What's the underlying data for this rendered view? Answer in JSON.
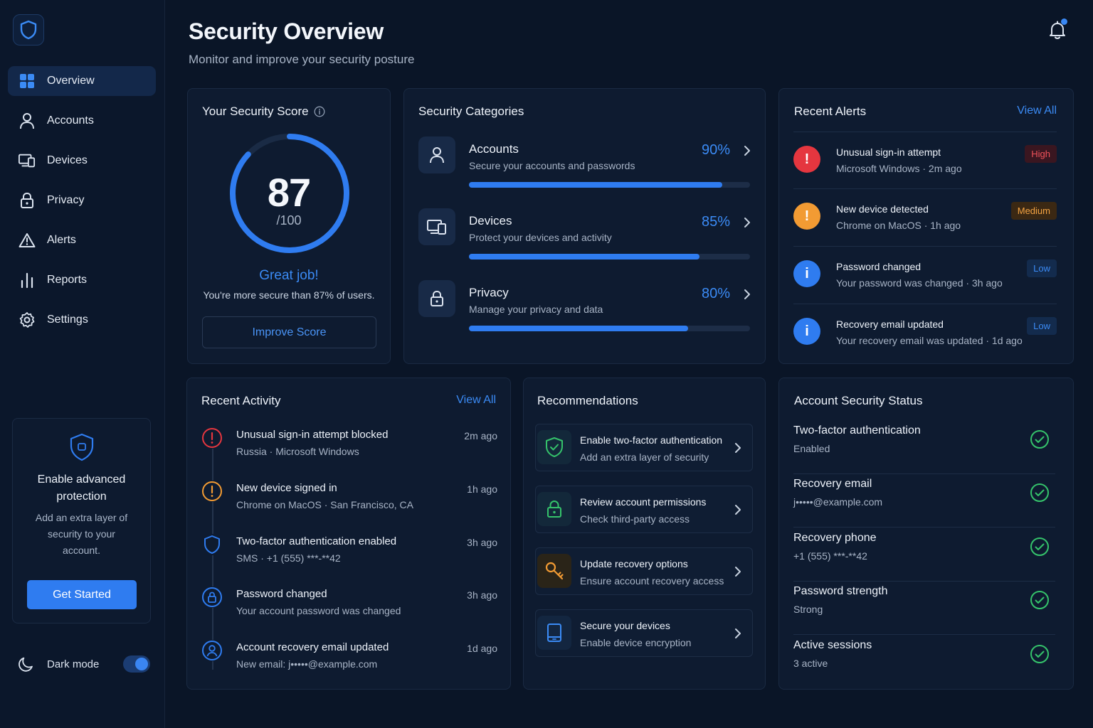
{
  "colors": {
    "accent": "#2f7cf0",
    "success": "#35c36b",
    "danger": "#e5363f",
    "warning": "#f29b33",
    "info": "#2f7cf0",
    "background": "#0a1527"
  },
  "sidebar": {
    "logo_icon": "shield-icon",
    "items": [
      {
        "label": "Overview",
        "icon": "grid-icon",
        "active": true
      },
      {
        "label": "Accounts",
        "icon": "user-icon"
      },
      {
        "label": "Devices",
        "icon": "devices-icon"
      },
      {
        "label": "Privacy",
        "icon": "lock-icon"
      },
      {
        "label": "Alerts",
        "icon": "warning-icon"
      },
      {
        "label": "Reports",
        "icon": "bar-chart-icon"
      },
      {
        "label": "Settings",
        "icon": "gear-icon"
      }
    ],
    "promo": {
      "title": "Enable advanced protection",
      "description": "Add an extra layer of security to your account.",
      "button": "Get Started"
    },
    "dark_mode": {
      "label": "Dark mode",
      "enabled": true
    }
  },
  "header": {
    "title": "Security Overview",
    "subtitle": "Monitor and improve your security posture",
    "notification_dot": true
  },
  "score": {
    "title": "Your Security Score",
    "value": "87",
    "max": "/100",
    "fraction": 0.87,
    "headline": "Great job!",
    "message": "You're more secure than 87% of users.",
    "button": "Improve Score"
  },
  "categories": {
    "title": "Security Categories",
    "items": [
      {
        "name": "Accounts",
        "description": "Secure your accounts and passwords",
        "percent": "90%",
        "value": 0.9,
        "icon": "user-icon"
      },
      {
        "name": "Devices",
        "description": "Protect your devices and activity",
        "percent": "85%",
        "value": 0.82,
        "icon": "devices-icon"
      },
      {
        "name": "Privacy",
        "description": "Manage your privacy and data",
        "percent": "80%",
        "value": 0.78,
        "icon": "lock-icon"
      }
    ]
  },
  "alerts": {
    "title": "Recent Alerts",
    "view_all": "View All",
    "items": [
      {
        "title": "Unusual sign-in attempt",
        "subtitle": "Microsoft Windows · 2m ago",
        "badge": "High",
        "level": "danger",
        "glyph": "!"
      },
      {
        "title": "New device detected",
        "subtitle": "Chrome on MacOS · 1h ago",
        "badge": "Medium",
        "level": "warning",
        "glyph": "!"
      },
      {
        "title": "Password changed",
        "subtitle": "Your password was changed · 3h ago",
        "badge": "Low",
        "level": "info",
        "glyph": "i"
      },
      {
        "title": "Recovery email updated",
        "subtitle": "Your recovery email was updated · 1d ago",
        "badge": "Low",
        "level": "info",
        "glyph": "i"
      }
    ]
  },
  "activity": {
    "title": "Recent Activity",
    "view_all": "View All",
    "items": [
      {
        "title": "Unusual sign-in attempt blocked",
        "subtitle": "Russia · Microsoft Windows",
        "time": "2m ago",
        "icon": "alert-circle-icon"
      },
      {
        "title": "New device signed in",
        "subtitle": "Chrome on MacOS · San Francisco, CA",
        "time": "1h ago",
        "icon": "warning-circle-icon"
      },
      {
        "title": "Two-factor authentication enabled",
        "subtitle": "SMS · +1 (555) ***-**42",
        "time": "3h ago",
        "icon": "shield-icon"
      },
      {
        "title": "Password changed",
        "subtitle": "Your account password was changed",
        "time": "3h ago",
        "icon": "lock-circle-icon"
      },
      {
        "title": "Account recovery email updated",
        "subtitle": "New email: j•••••@example.com",
        "time": "1d ago",
        "icon": "user-circle-icon"
      }
    ]
  },
  "recommendations": {
    "title": "Recommendations",
    "items": [
      {
        "title": "Enable two-factor authentication",
        "subtitle": "Add an extra layer of security",
        "icon": "shield-check-icon"
      },
      {
        "title": "Review account permissions",
        "subtitle": "Check third-party access",
        "icon": "lock-icon"
      },
      {
        "title": "Update recovery options",
        "subtitle": "Ensure account recovery access",
        "icon": "key-icon"
      },
      {
        "title": "Secure your devices",
        "subtitle": "Enable device encryption",
        "icon": "tablet-icon"
      }
    ]
  },
  "status": {
    "title": "Account Security Status",
    "items": [
      {
        "title": "Two-factor authentication",
        "value": "Enabled"
      },
      {
        "title": "Recovery email",
        "value": "j•••••@example.com"
      },
      {
        "title": "Recovery phone",
        "value": "+1 (555) ***-**42"
      },
      {
        "title": "Password strength",
        "value": "Strong"
      },
      {
        "title": "Active sessions",
        "value": "3 active"
      }
    ]
  }
}
